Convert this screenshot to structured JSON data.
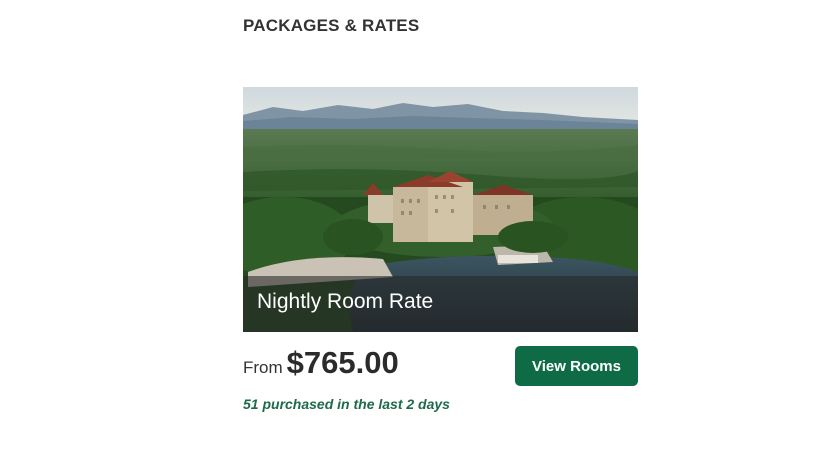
{
  "section": {
    "title": "PACKAGES & RATES"
  },
  "package": {
    "image_subject": "aerial view of mountain resort hotel by a lake",
    "name": "Nightly Room Rate",
    "price_prefix": "From",
    "price": "$765.00",
    "cta_label": "View Rooms",
    "purchase_note": "51 purchased in the last 2 days"
  },
  "colors": {
    "button_background": "#0e6b45",
    "purchase_note": "#1e6a4a",
    "caption_overlay": "rgba(40,40,40,0.58)"
  }
}
